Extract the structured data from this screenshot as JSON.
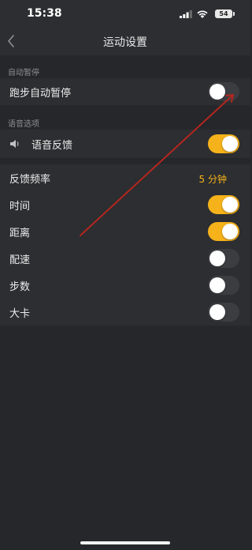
{
  "status_bar": {
    "time": "15:38",
    "battery": "54"
  },
  "nav": {
    "title": "运动设置"
  },
  "auto_pause": {
    "section_label": "自动暂停",
    "items": [
      {
        "label": "跑步自动暂停",
        "on": false
      }
    ]
  },
  "voice": {
    "section_label": "语音选项",
    "items": [
      {
        "label": "语音反馈",
        "on": true
      }
    ]
  },
  "feedback": {
    "frequency_label": "反馈频率",
    "frequency_value": "5 分钟",
    "items": [
      {
        "label": "时间",
        "on": true
      },
      {
        "label": "距离",
        "on": true
      },
      {
        "label": "配速",
        "on": false
      },
      {
        "label": "步数",
        "on": false
      },
      {
        "label": "大卡",
        "on": false
      }
    ]
  },
  "colors": {
    "accent": "#f5b21a",
    "background": "#25272a",
    "row_background": "#2c2e31",
    "annotation_arrow": "#b3261e"
  }
}
